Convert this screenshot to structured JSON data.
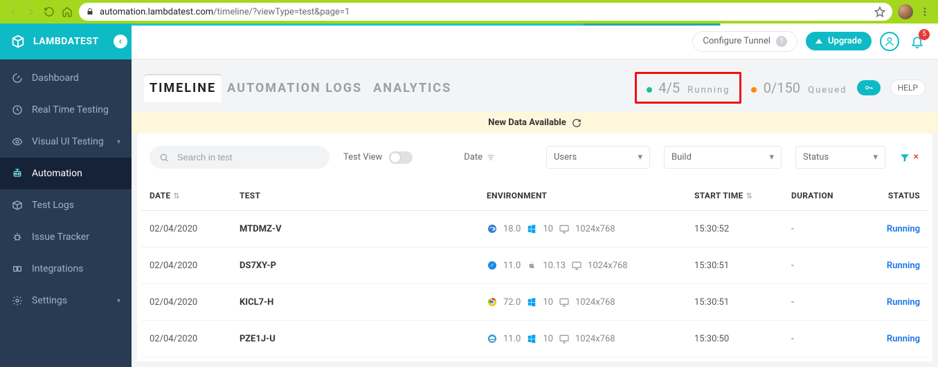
{
  "browser": {
    "url_host": "automation.lambdatest.com",
    "url_path": "/timeline/?viewType=test&page=1"
  },
  "brand": {
    "name": "LAMBDATEST"
  },
  "sidebar": {
    "items": [
      {
        "label": "Dashboard",
        "icon": "gauge-icon",
        "active": false,
        "hasChevron": false
      },
      {
        "label": "Real Time Testing",
        "icon": "clock-icon",
        "active": false,
        "hasChevron": false
      },
      {
        "label": "Visual UI Testing",
        "icon": "eye-icon",
        "active": false,
        "hasChevron": true
      },
      {
        "label": "Automation",
        "icon": "robot-icon",
        "active": true,
        "hasChevron": false
      },
      {
        "label": "Test Logs",
        "icon": "box-icon",
        "active": false,
        "hasChevron": false
      },
      {
        "label": "Issue Tracker",
        "icon": "bug-icon",
        "active": false,
        "hasChevron": false
      },
      {
        "label": "Integrations",
        "icon": "puzzle-icon",
        "active": false,
        "hasChevron": false
      },
      {
        "label": "Settings",
        "icon": "gear-icon",
        "active": false,
        "hasChevron": true
      }
    ]
  },
  "topbar": {
    "configure_tunnel": "Configure Tunnel",
    "upgrade": "Upgrade",
    "notifications": "5"
  },
  "tabs": [
    {
      "label": "TIMELINE",
      "active": true
    },
    {
      "label": "AUTOMATION LOGS",
      "active": false
    },
    {
      "label": "ANALYTICS",
      "active": false
    }
  ],
  "status": {
    "running_count": "4/5",
    "running_label": "Running",
    "queued_count": "0/150",
    "queued_label": "Queued"
  },
  "banner": {
    "text": "New Data Available"
  },
  "help": {
    "label": "HELP"
  },
  "filters": {
    "search_placeholder": "Search in test",
    "test_view_label": "Test View",
    "date_label": "Date",
    "users_label": "Users",
    "build_label": "Build",
    "status_label": "Status"
  },
  "table": {
    "columns": {
      "date": "DATE",
      "test": "TEST",
      "environment": "ENVIRONMENT",
      "start_time": "START TIME",
      "duration": "DURATION",
      "status": "STATUS"
    },
    "rows": [
      {
        "date": "02/04/2020",
        "test": "MTDMZ-V",
        "env": {
          "browser_icon": "edge-icon",
          "browser_ver": "18.0",
          "os_icon": "windows-icon",
          "os_ver": "10",
          "res": "1024x768"
        },
        "start_time": "15:30:52",
        "duration": "-",
        "status": "Running"
      },
      {
        "date": "02/04/2020",
        "test": "DS7XY-P",
        "env": {
          "browser_icon": "safari-icon",
          "browser_ver": "11.0",
          "os_icon": "apple-icon",
          "os_ver": "10.13",
          "res": "1024x768"
        },
        "start_time": "15:30:51",
        "duration": "-",
        "status": "Running"
      },
      {
        "date": "02/04/2020",
        "test": "KICL7-H",
        "env": {
          "browser_icon": "chrome-icon",
          "browser_ver": "72.0",
          "os_icon": "windows-icon",
          "os_ver": "10",
          "res": "1024x768"
        },
        "start_time": "15:30:51",
        "duration": "-",
        "status": "Running"
      },
      {
        "date": "02/04/2020",
        "test": "PZE1J-U",
        "env": {
          "browser_icon": "ie-icon",
          "browser_ver": "11.0",
          "os_icon": "windows-icon",
          "os_ver": "10",
          "res": "1024x768"
        },
        "start_time": "15:30:50",
        "duration": "-",
        "status": "Running"
      }
    ]
  }
}
